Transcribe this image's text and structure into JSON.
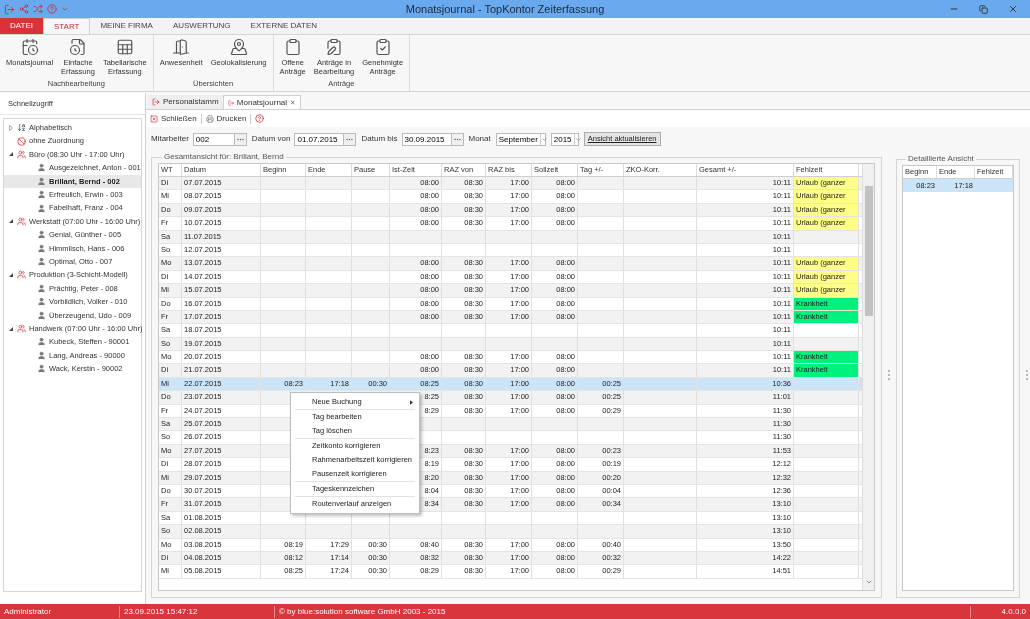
{
  "window": {
    "title": "Monatsjournal - TopKontor Zeiterfassung"
  },
  "ribbon": {
    "tabs": [
      {
        "label": "DATEI",
        "kind": "file",
        "selected": false
      },
      {
        "label": "START",
        "kind": "tab",
        "selected": true
      },
      {
        "label": "MEINE FIRMA",
        "kind": "tab",
        "selected": false
      },
      {
        "label": "AUSWERTUNG",
        "kind": "tab",
        "selected": false
      },
      {
        "label": "EXTERNE DATEN",
        "kind": "tab",
        "selected": false
      }
    ],
    "groups": [
      {
        "label": "Nachbearbeitung",
        "buttons": [
          "Monatsjournal",
          "Einfache\nErfassung",
          "Tabellarische\nErfassung"
        ]
      },
      {
        "label": "Übersichten",
        "buttons": [
          "Anwesenheit",
          "Geolokalisierung"
        ]
      },
      {
        "label": "Anträge",
        "buttons": [
          "Offene\nAnträge",
          "Anträge in\nBearbeitung",
          "Genehmigte\nAnträge"
        ]
      }
    ]
  },
  "sidebar": {
    "title": "Schnellzugriff",
    "tree": [
      {
        "label": "Alphabetisch",
        "kind": "sort",
        "expanded": false,
        "selected": false
      },
      {
        "label": "ohne Zuordnung",
        "kind": "none",
        "selected": false
      },
      {
        "label": "Büro (08:30 Uhr - 17:00 Uhr)",
        "kind": "group",
        "expanded": true,
        "selected": false,
        "children": [
          {
            "label": "Ausgezeichnet, Anton - 001",
            "kind": "person",
            "selected": false
          },
          {
            "label": "Brillant, Bernd - 002",
            "kind": "person",
            "selected": true
          },
          {
            "label": "Erfreulich, Erwin - 003",
            "kind": "person",
            "selected": false
          },
          {
            "label": "Fabelhaft, Franz - 004",
            "kind": "person",
            "selected": false
          }
        ]
      },
      {
        "label": "Werkstatt (07:00 Uhr - 16:00 Uhr)",
        "kind": "group",
        "expanded": true,
        "selected": false,
        "children": [
          {
            "label": "Genial, Günther - 005",
            "kind": "person",
            "selected": false
          },
          {
            "label": "Himmlisch, Hans - 006",
            "kind": "person",
            "selected": false
          },
          {
            "label": "Optimal, Otto - 007",
            "kind": "person",
            "selected": false
          }
        ]
      },
      {
        "label": "Produktion (3-Schicht-Modell)",
        "kind": "group",
        "expanded": true,
        "selected": false,
        "children": [
          {
            "label": "Prächtig, Peter - 008",
            "kind": "person",
            "selected": false
          },
          {
            "label": "Vorbildlich, Volker - 010",
            "kind": "person",
            "selected": false
          },
          {
            "label": "Überzeugend, Udo - 009",
            "kind": "person",
            "selected": false
          }
        ]
      },
      {
        "label": "Handwerk (07:00 Uhr - 16:00 Uhr)",
        "kind": "group",
        "expanded": true,
        "selected": false,
        "children": [
          {
            "label": "Kubeck, Steffen - 90001",
            "kind": "person",
            "selected": false
          },
          {
            "label": "Lang, Andreas - 90000",
            "kind": "person",
            "selected": false
          },
          {
            "label": "Wack, Kerstin - 90002",
            "kind": "person",
            "selected": false
          }
        ]
      }
    ]
  },
  "doc_tabs": [
    {
      "label": "Personalstamm",
      "selected": false,
      "closable": false
    },
    {
      "label": "Monatsjournal",
      "selected": true,
      "closable": true
    }
  ],
  "toolbar": [
    "Schließen",
    "Drucken"
  ],
  "filters": {
    "employee": {
      "label": "Mitarbeiter",
      "value": "002"
    },
    "date_from": {
      "label": "Datum von",
      "value": "01.07.2015"
    },
    "date_to": {
      "label": "Datum bis",
      "value": "30.09.2015"
    },
    "month": {
      "label": "Monat",
      "value": "September"
    },
    "year": {
      "value": "2015"
    },
    "refresh_button": "Ansicht aktualisieren"
  },
  "overview": {
    "title": "Gesamtansicht für: Brillant, Bernd",
    "table": {
      "columns": [
        "WT",
        "Datum",
        "Beginn",
        "Ende",
        "Pause",
        "Ist-Zeit",
        "RAZ von",
        "RAZ bis",
        "Sollzeit",
        "Tag +/-",
        "ZKO-Korr.",
        "Gesamt +/-",
        "Fehlzeit"
      ],
      "rows": [
        {
          "cells": [
            "Di",
            "07.07.2015",
            "",
            "",
            "",
            "08:00",
            "08:30",
            "17:00",
            "08:00",
            "",
            "",
            "10:11",
            "Urlaub (ganzer"
          ],
          "selected": false,
          "color": "#ffff88"
        },
        {
          "cells": [
            "Mi",
            "08.07.2015",
            "",
            "",
            "",
            "08:00",
            "08:30",
            "17:00",
            "08:00",
            "",
            "",
            "10:11",
            "Urlaub (ganzer"
          ],
          "selected": false,
          "color": "#ffff88"
        },
        {
          "cells": [
            "Do",
            "09.07.2015",
            "",
            "",
            "",
            "08:00",
            "08:30",
            "17:00",
            "08:00",
            "",
            "",
            "10:11",
            "Urlaub (ganzer"
          ],
          "selected": false,
          "color": "#ffff88"
        },
        {
          "cells": [
            "Fr",
            "10.07.2015",
            "",
            "",
            "",
            "08:00",
            "08:30",
            "17:00",
            "08:00",
            "",
            "",
            "10:11",
            "Urlaub (ganzer"
          ],
          "selected": false,
          "color": "#ffff88"
        },
        {
          "cells": [
            "Sa",
            "11.07.2015",
            "",
            "",
            "",
            "",
            "",
            "",
            "",
            "",
            "",
            "10:11",
            ""
          ],
          "selected": false
        },
        {
          "cells": [
            "So",
            "12.07.2015",
            "",
            "",
            "",
            "",
            "",
            "",
            "",
            "",
            "",
            "10:11",
            ""
          ],
          "selected": false
        },
        {
          "cells": [
            "Mo",
            "13.07.2015",
            "",
            "",
            "",
            "08:00",
            "08:30",
            "17:00",
            "08:00",
            "",
            "",
            "10:11",
            "Urlaub (ganzer"
          ],
          "selected": false,
          "color": "#ffff88"
        },
        {
          "cells": [
            "Di",
            "14.07.2015",
            "",
            "",
            "",
            "08:00",
            "08:30",
            "17:00",
            "08:00",
            "",
            "",
            "10:11",
            "Urlaub (ganzer"
          ],
          "selected": false,
          "color": "#ffff88"
        },
        {
          "cells": [
            "Mi",
            "15.07.2015",
            "",
            "",
            "",
            "08:00",
            "08:30",
            "17:00",
            "08:00",
            "",
            "",
            "10:11",
            "Urlaub (ganzer"
          ],
          "selected": false,
          "color": "#ffff88"
        },
        {
          "cells": [
            "Do",
            "16.07.2015",
            "",
            "",
            "",
            "08:00",
            "08:30",
            "17:00",
            "08:00",
            "",
            "",
            "10:11",
            "Krankheit"
          ],
          "selected": false,
          "color": "#00f07c"
        },
        {
          "cells": [
            "Fr",
            "17.07.2015",
            "",
            "",
            "",
            "08:00",
            "08:30",
            "17:00",
            "08:00",
            "",
            "",
            "10:11",
            "Krankheit"
          ],
          "selected": false,
          "color": "#00f07c"
        },
        {
          "cells": [
            "Sa",
            "18.07.2015",
            "",
            "",
            "",
            "",
            "",
            "",
            "",
            "",
            "",
            "10:11",
            ""
          ],
          "selected": false
        },
        {
          "cells": [
            "So",
            "19.07.2015",
            "",
            "",
            "",
            "",
            "",
            "",
            "",
            "",
            "",
            "10:11",
            ""
          ],
          "selected": false
        },
        {
          "cells": [
            "Mo",
            "20.07.2015",
            "",
            "",
            "",
            "08:00",
            "08:30",
            "17:00",
            "08:00",
            "",
            "",
            "10:11",
            "Krankheit"
          ],
          "selected": false,
          "color": "#00f07c"
        },
        {
          "cells": [
            "Di",
            "21.07.2015",
            "",
            "",
            "",
            "08:00",
            "08:30",
            "17:00",
            "08:00",
            "",
            "",
            "10:11",
            "Krankheit"
          ],
          "selected": false,
          "color": "#00f07c"
        },
        {
          "cells": [
            "Mi",
            "22.07.2015",
            "08:23",
            "17:18",
            "00:30",
            "08:25",
            "08:30",
            "17:00",
            "08:00",
            "00:25",
            "",
            "10:36",
            ""
          ],
          "selected": true
        },
        {
          "cells": [
            "Do",
            "23.07.2015",
            "",
            "",
            "",
            "8:25",
            "08:30",
            "17:00",
            "08:00",
            "00:25",
            "",
            "11:01",
            ""
          ],
          "selected": false
        },
        {
          "cells": [
            "Fr",
            "24.07.2015",
            "",
            "",
            "",
            "8:29",
            "08:30",
            "17:00",
            "08:00",
            "00:29",
            "",
            "11:30",
            ""
          ],
          "selected": false
        },
        {
          "cells": [
            "Sa",
            "25.07.2015",
            "",
            "",
            "",
            "",
            "",
            "",
            "",
            "",
            "",
            "11:30",
            ""
          ],
          "selected": false
        },
        {
          "cells": [
            "So",
            "26.07.2015",
            "",
            "",
            "",
            "",
            "",
            "",
            "",
            "",
            "",
            "11:30",
            ""
          ],
          "selected": false
        },
        {
          "cells": [
            "Mo",
            "27.07.2015",
            "",
            "",
            "",
            "8:23",
            "08:30",
            "17:00",
            "08:00",
            "00:23",
            "",
            "11:53",
            ""
          ],
          "selected": false
        },
        {
          "cells": [
            "Di",
            "28.07.2015",
            "",
            "",
            "",
            "8:19",
            "08:30",
            "17:00",
            "08:00",
            "00:19",
            "",
            "12:12",
            ""
          ],
          "selected": false
        },
        {
          "cells": [
            "Mi",
            "29.07.2015",
            "",
            "",
            "",
            "8:20",
            "08:30",
            "17:00",
            "08:00",
            "00:20",
            "",
            "12:32",
            ""
          ],
          "selected": false
        },
        {
          "cells": [
            "Do",
            "30.07.2015",
            "",
            "",
            "",
            "8:04",
            "08:30",
            "17:00",
            "08:00",
            "00:04",
            "",
            "12:36",
            ""
          ],
          "selected": false
        },
        {
          "cells": [
            "Fr",
            "31.07.2015",
            "",
            "",
            "",
            "8:34",
            "08:30",
            "17:00",
            "08:00",
            "00:34",
            "",
            "13:10",
            ""
          ],
          "selected": false
        },
        {
          "cells": [
            "Sa",
            "01.08.2015",
            "",
            "",
            "",
            "",
            "",
            "",
            "",
            "",
            "",
            "13:10",
            ""
          ],
          "selected": false
        },
        {
          "cells": [
            "So",
            "02.08.2015",
            "",
            "",
            "",
            "",
            "",
            "",
            "",
            "",
            "",
            "13:10",
            ""
          ],
          "selected": false
        },
        {
          "cells": [
            "Mo",
            "03.08.2015",
            "08:19",
            "17:29",
            "00:30",
            "08:40",
            "08:30",
            "17:00",
            "08:00",
            "00:40",
            "",
            "13:50",
            ""
          ],
          "selected": false
        },
        {
          "cells": [
            "Di",
            "04.08.2015",
            "08:12",
            "17:14",
            "00:30",
            "08:32",
            "08:30",
            "17:00",
            "08:00",
            "00:32",
            "",
            "14:22",
            ""
          ],
          "selected": false
        },
        {
          "cells": [
            "Mi",
            "05.08.2015",
            "08:25",
            "17:24",
            "00:30",
            "08:29",
            "08:30",
            "17:00",
            "08:00",
            "00:29",
            "",
            "14:51",
            ""
          ],
          "selected": false
        }
      ]
    },
    "context_menu": {
      "groups": [
        [
          {
            "label": "Neue Buchung",
            "submenu": true
          }
        ],
        [
          {
            "label": "Tag bearbeiten",
            "submenu": false
          },
          {
            "label": "Tag löschen",
            "submenu": false
          }
        ],
        [
          {
            "label": "Zeitkonto korrigieren",
            "submenu": false
          },
          {
            "label": "Rahmenarbeitszeit korrigieren",
            "submenu": false
          },
          {
            "label": "Pausenzeit korrigieren",
            "submenu": false
          }
        ],
        [
          {
            "label": "Tageskennzeichen",
            "submenu": false
          }
        ],
        [
          {
            "label": "Routenverlauf anzeigen",
            "submenu": false
          }
        ]
      ]
    }
  },
  "detail": {
    "title": "Detaillierte Ansicht",
    "table": {
      "columns": [
        "Beginn",
        "Ende",
        "Fehlzeit"
      ],
      "rows": [
        {
          "cells": [
            "08:23",
            "17:18",
            ""
          ],
          "selected": true
        }
      ]
    }
  },
  "status_bar": {
    "user": "Administrator",
    "timestamp": "23.09.2015 15:47:12",
    "copyright": "© by blue:solution software GmbH 2003 - 2015",
    "version": "4.0.0.0"
  }
}
